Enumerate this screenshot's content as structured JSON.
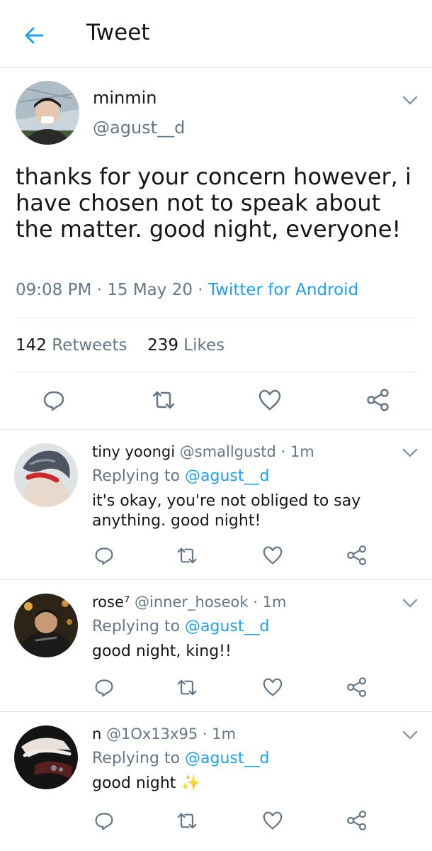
{
  "header": {
    "title": "Tweet"
  },
  "tweet": {
    "name": "minmin",
    "handle": "@agust__d",
    "text": "thanks for your concern however, i have chosen not to speak about the matter. good night, everyone!",
    "time": "09:08 PM",
    "date": "15 May 20",
    "source": "Twitter for Android",
    "retweets": "142",
    "retweets_label": "Retweets",
    "likes": "239",
    "likes_label": "Likes"
  },
  "replies": [
    {
      "name": "tiny yoongi",
      "handle": "@smallgustd",
      "time": "1m",
      "replying_label": "Replying to",
      "replying_to": "@agust__d",
      "text": "it's okay, you're not obliged to say anything. good night!"
    },
    {
      "name": "rose⁷",
      "handle": "@inner_hoseok",
      "time": "1m",
      "replying_label": "Replying to",
      "replying_to": "@agust__d",
      "text": "good night, king!!"
    },
    {
      "name": "n",
      "handle": "@1Ox13x95",
      "time": "1m",
      "replying_label": "Replying to",
      "replying_to": "@agust__d",
      "text": "good night",
      "emoji": "✨"
    }
  ],
  "colors": {
    "accent": "#1da1f2",
    "muted": "#657786",
    "text": "#14171a",
    "border": "#e1e8ed",
    "sparkle": "#f5c542"
  },
  "icons": [
    "back-arrow-icon",
    "chevron-down-icon",
    "reply-icon",
    "retweet-icon",
    "like-icon",
    "share-icon"
  ]
}
